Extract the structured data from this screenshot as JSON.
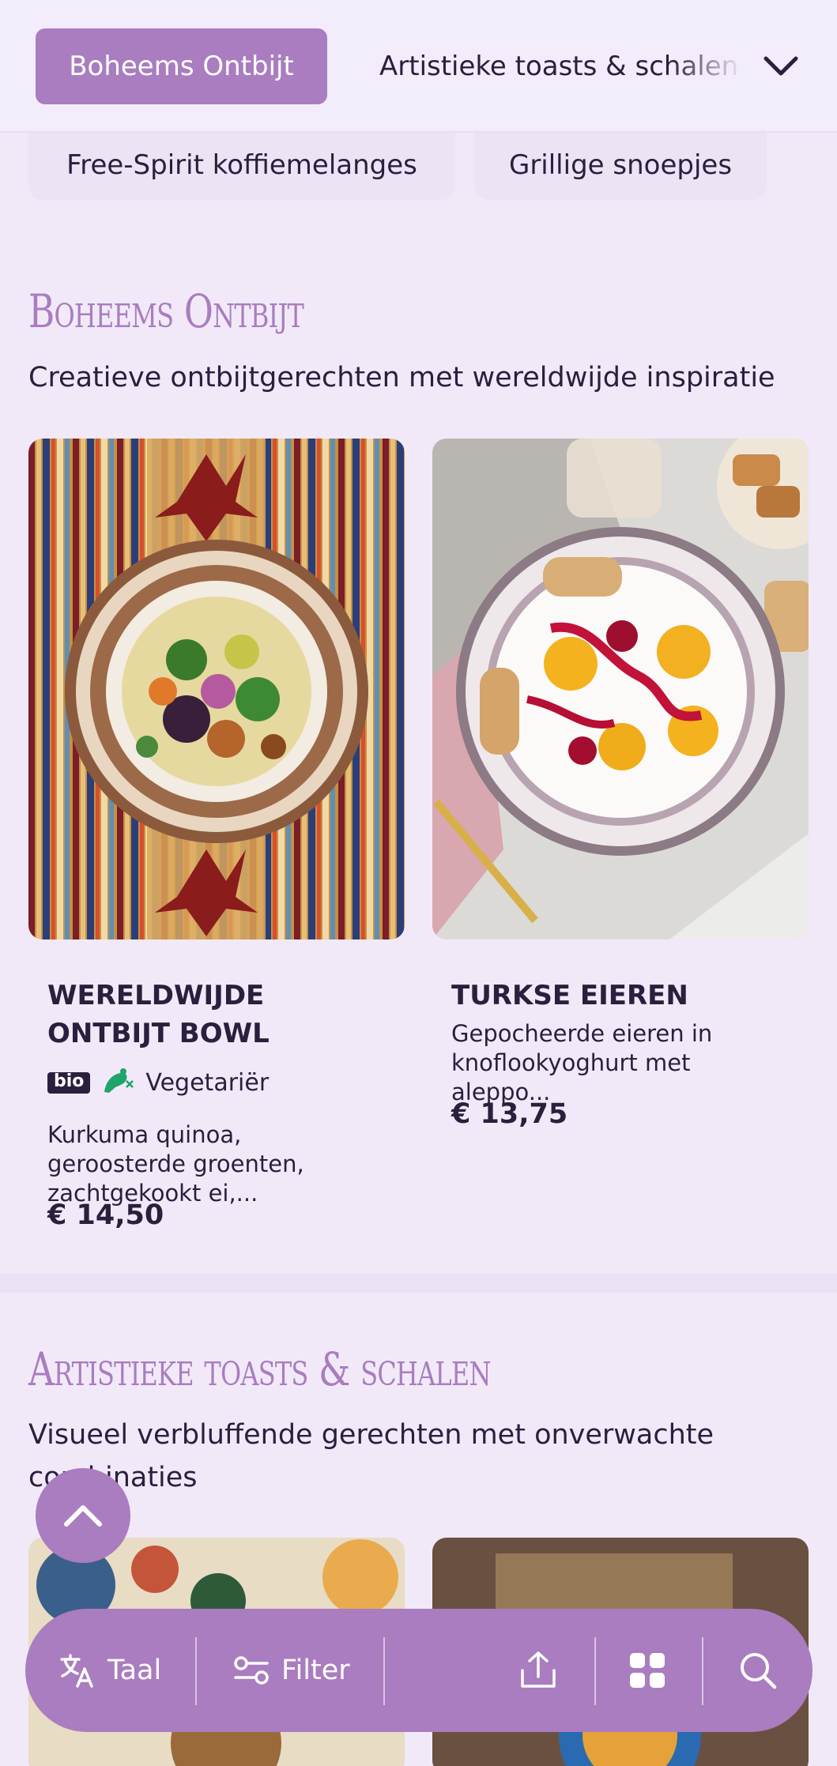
{
  "nav": {
    "active_tab": "Boheems Ontbijt",
    "next_tab": "Artistieke toasts & schalen",
    "chips": [
      "Free-Spirit koffiemelanges",
      "Grillige snoepjes"
    ]
  },
  "sections": [
    {
      "title": "Boheems Ontbijt",
      "subtitle": "Creatieve ontbijtgerechten met wereldwijde inspiratie",
      "items": [
        {
          "name": "Wereldwijde Ontbijt Bowl",
          "badges": [
            "bio"
          ],
          "diet": "Vegetariër",
          "description": "Kurkuma quinoa, geroosterde groenten, zachtgekookt ei,...",
          "price": "€ 14,50"
        },
        {
          "name": "Turkse eieren",
          "description": "Gepocheerde eieren in knoflookyoghurt met aleppo...",
          "price": "€ 13,75"
        }
      ]
    },
    {
      "title": "Artistieke toasts & schalen",
      "subtitle": "Visueel verbluffende gerechten met onverwachte combinaties"
    }
  ],
  "bottom_bar": {
    "language_label": "Taal",
    "filter_label": "Filter",
    "icons": [
      "translate-icon",
      "filter-icon",
      "share-icon",
      "grid-icon",
      "search-icon"
    ]
  },
  "colors": {
    "accent": "#a97dbf",
    "background": "#f1e9f8",
    "text": "#2a1f3d",
    "veg_green": "#1fa46a"
  }
}
